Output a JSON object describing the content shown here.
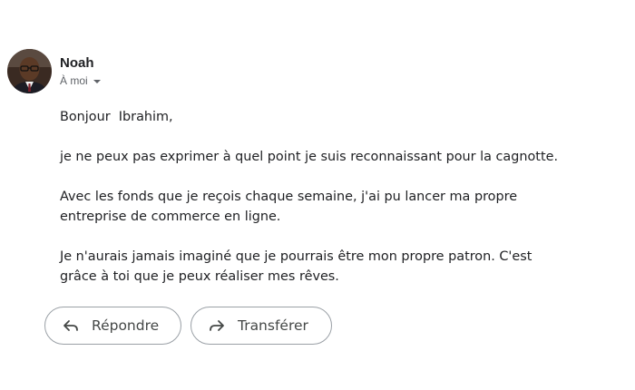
{
  "sender": {
    "name": "Noah",
    "recipient_label": "À moi"
  },
  "message": {
    "paragraphs": [
      "Bonjour  Ibrahim,",
      "je ne peux pas exprimer à quel point je suis reconnaissant pour la cagnotte.",
      "Avec les fonds que je reçois chaque semaine, j'ai pu lancer ma propre\nentreprise de commerce en ligne.",
      "Je n'aurais jamais imaginé que je pourrais être mon propre patron. C'est\ngrâce à toi que je peux réaliser mes rêves."
    ]
  },
  "actions": {
    "reply_label": "Répondre",
    "forward_label": "Transférer"
  },
  "icons": {
    "avatar": "avatar-photo",
    "recipient_dropdown": "chevron-down-icon",
    "reply": "reply-arrow-icon",
    "forward": "forward-arrow-icon"
  }
}
